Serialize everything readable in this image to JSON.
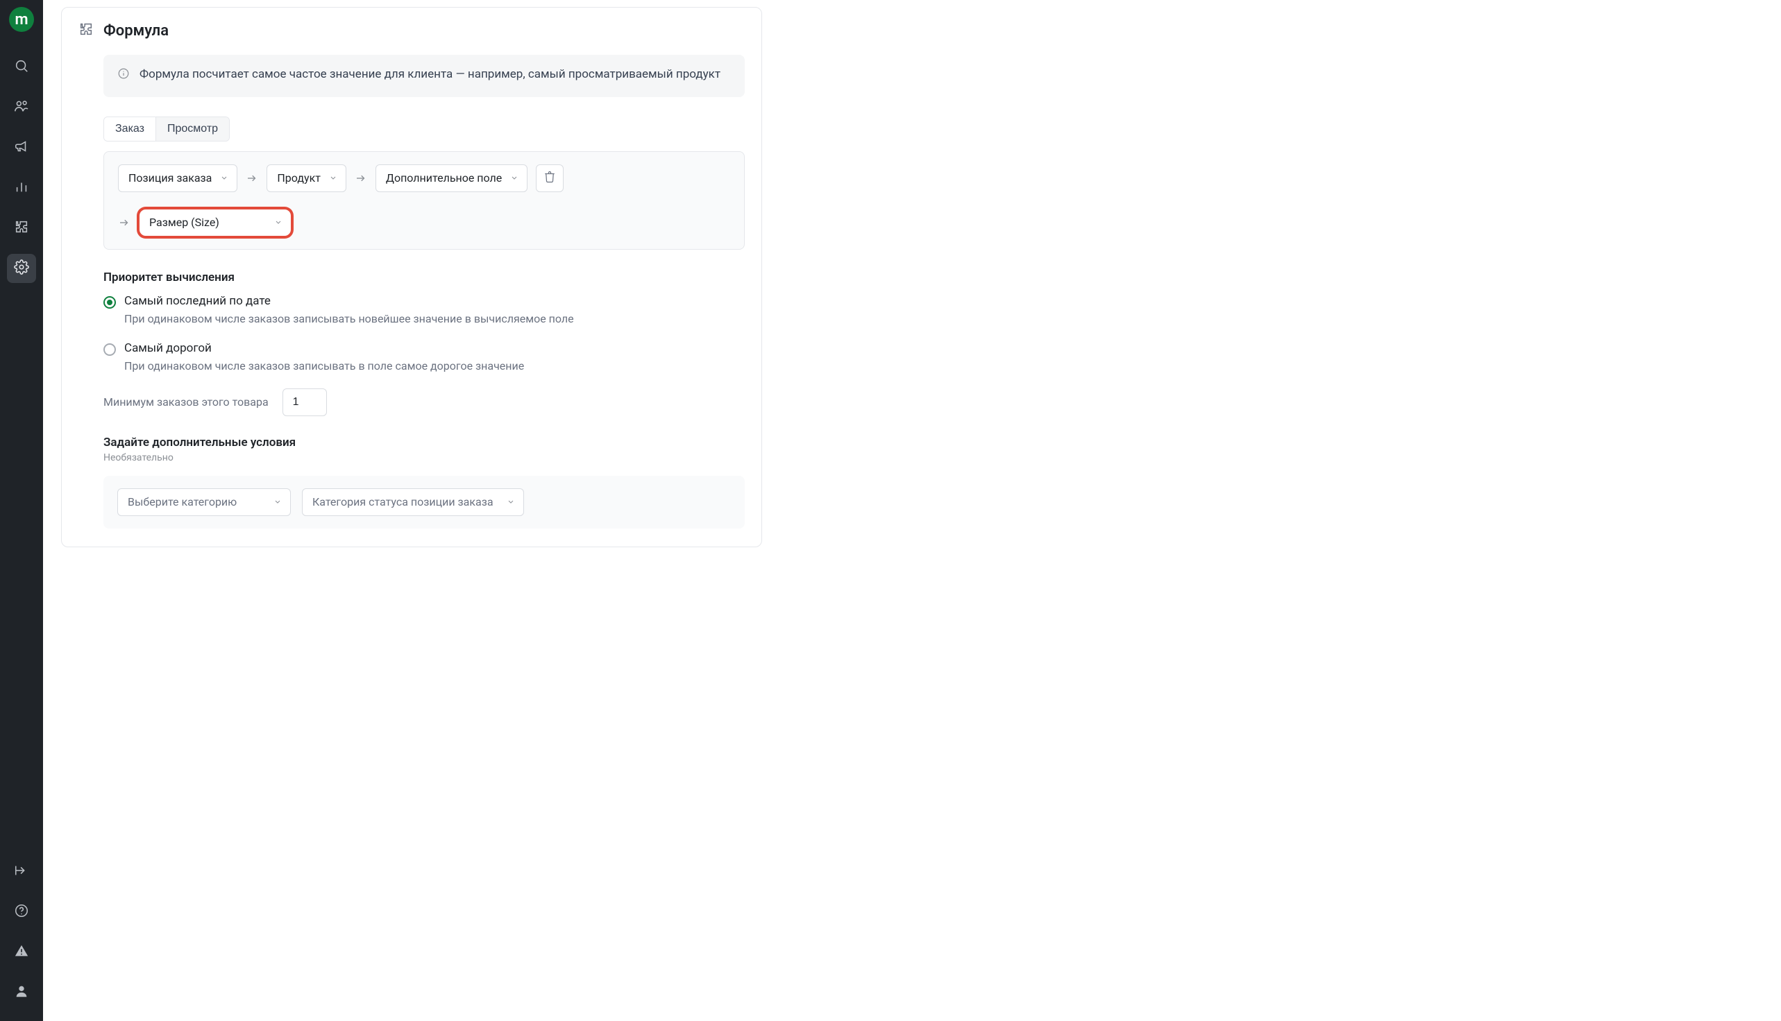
{
  "sidebar": {
    "logo_letter": "m"
  },
  "header": {
    "title": "Формула"
  },
  "info": {
    "text": "Формула посчитает самое частое значение для клиента — например, самый просматриваемый продукт"
  },
  "tabs": {
    "order": "Заказ",
    "view": "Просмотр",
    "active": "order"
  },
  "chain": {
    "step1": "Позиция заказа",
    "step2": "Продукт",
    "step3": "Дополнительное поле",
    "step4": "Размер (Size)"
  },
  "priority": {
    "heading": "Приоритет вычисления",
    "opt_latest": {
      "label": "Самый последний по дате",
      "desc": "При одинаковом числе заказов записывать новейшее значение в вычисляемое поле"
    },
    "opt_expensive": {
      "label": "Самый дорогой",
      "desc": "При одинаковом числе заказов записывать в поле самое дорогое значение"
    },
    "selected": "latest"
  },
  "min_orders": {
    "label": "Минимум заказов этого товара",
    "value": "1"
  },
  "conditions": {
    "title": "Задайте дополнительные условия",
    "subtitle": "Необязательно",
    "category_placeholder": "Выберите категорию",
    "status_category": "Категория статуса позиции заказа"
  }
}
